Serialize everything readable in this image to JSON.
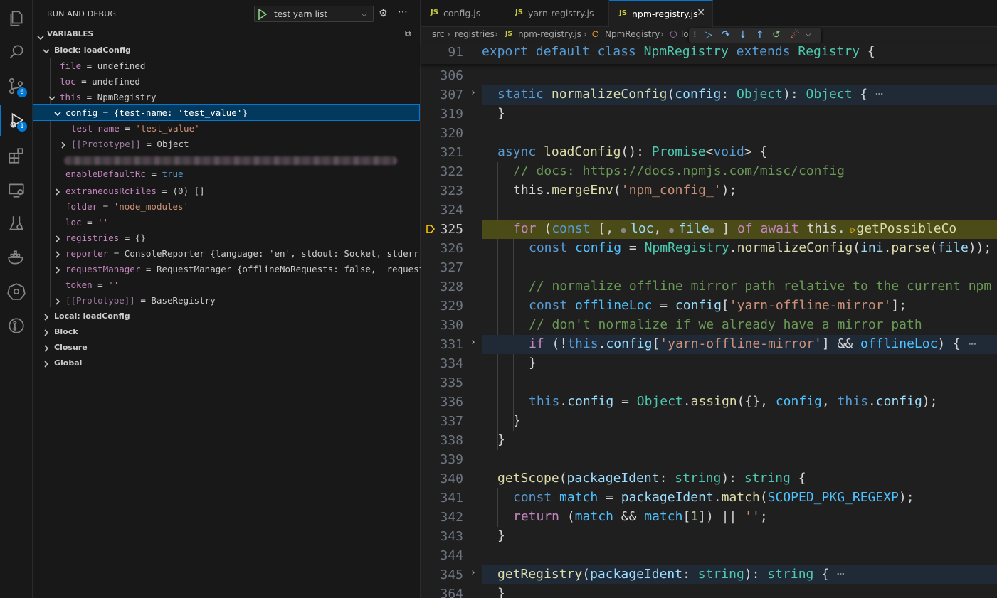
{
  "activity_bar": {
    "items": [
      {
        "name": "explorer",
        "icon": "files-icon"
      },
      {
        "name": "search",
        "icon": "search-icon"
      },
      {
        "name": "source-control",
        "icon": "source-control-icon",
        "badge": "6"
      },
      {
        "name": "run-and-debug",
        "icon": "debug-icon",
        "badge": "1",
        "active": true
      },
      {
        "name": "extensions",
        "icon": "extensions-icon"
      },
      {
        "name": "remote-explorer",
        "icon": "remote-explorer-icon"
      },
      {
        "name": "testing",
        "icon": "testing-icon"
      },
      {
        "name": "docker",
        "icon": "docker-icon"
      },
      {
        "name": "kubernetes",
        "icon": "kubernetes-icon"
      },
      {
        "name": "gitlens",
        "icon": "gitlens-icon"
      }
    ]
  },
  "sidebar": {
    "title": "RUN AND DEBUG",
    "launch_config": "test yarn list",
    "variables_title": "VARIABLES",
    "scopes": {
      "block_loadconfig": "Block: loadConfig",
      "local_loadconfig": "Local: loadConfig",
      "block": "Block",
      "closure": "Closure",
      "global": "Global"
    },
    "vars": {
      "file": {
        "name": "file",
        "value": "undefined"
      },
      "loc": {
        "name": "loc",
        "value": "undefined"
      },
      "this": {
        "name": "this",
        "value": "NpmRegistry"
      },
      "config": {
        "name": "config",
        "value": "{test-name: 'test_value'}"
      },
      "test_name": {
        "name": "test-name",
        "value": "'test_value'"
      },
      "proto1": {
        "name": "[[Prototype]]",
        "value": "Object"
      },
      "enable_default_rc": {
        "name": "enableDefaultRc",
        "value": "true"
      },
      "extraneous": {
        "name": "extraneousRcFiles",
        "value": "(0) []"
      },
      "folder": {
        "name": "folder",
        "value": "'node_modules'"
      },
      "loc2": {
        "name": "loc",
        "value": "''"
      },
      "registries": {
        "name": "registries",
        "value": "{}"
      },
      "reporter": {
        "name": "reporter",
        "value": "ConsoleReporter {language: 'en', stdout: Socket, stderr: …"
      },
      "request_manager": {
        "name": "requestManager",
        "value": "RequestManager {offlineNoRequests: false, _requestC…"
      },
      "token": {
        "name": "token",
        "value": "''"
      },
      "proto2": {
        "name": "[[Prototype]]",
        "value": "BaseRegistry"
      }
    }
  },
  "editor": {
    "tabs": [
      {
        "label": "config.js",
        "badge": "JS",
        "active": false
      },
      {
        "label": "yarn-registry.js",
        "badge": "JS",
        "active": false
      },
      {
        "label": "npm-registry.js",
        "badge": "JS",
        "active": true
      }
    ],
    "breadcrumbs": [
      "src",
      "registries",
      "npm-registry.js",
      "NpmRegistry",
      "lo"
    ],
    "sticky_line": {
      "num": "91",
      "text": "export default class NpmRegistry extends Registry {"
    },
    "current_line": "325",
    "lines": [
      {
        "num": "306"
      },
      {
        "num": "307"
      },
      {
        "num": "319"
      },
      {
        "num": "320"
      },
      {
        "num": "321"
      },
      {
        "num": "322"
      },
      {
        "num": "323"
      },
      {
        "num": "324"
      },
      {
        "num": "325"
      },
      {
        "num": "326"
      },
      {
        "num": "327"
      },
      {
        "num": "328"
      },
      {
        "num": "329"
      },
      {
        "num": "330"
      },
      {
        "num": "331"
      },
      {
        "num": "334"
      },
      {
        "num": "335"
      },
      {
        "num": "336"
      },
      {
        "num": "337"
      },
      {
        "num": "338"
      },
      {
        "num": "339"
      },
      {
        "num": "340"
      },
      {
        "num": "341"
      },
      {
        "num": "342"
      },
      {
        "num": "343"
      },
      {
        "num": "344"
      },
      {
        "num": "345"
      },
      {
        "num": "364"
      }
    ],
    "tokens": {
      "l307": [
        "static",
        "normalizeConfig",
        "(",
        "config",
        ": ",
        "Object",
        "): ",
        "Object",
        " {",
        "⋯"
      ],
      "l319": [
        "}"
      ],
      "l321": [
        "async",
        "loadConfig",
        "(): ",
        "Promise",
        "<",
        "void",
        "> {"
      ],
      "l322": [
        "// docs: ",
        "https://docs.npmjs.com/misc/config"
      ],
      "l323": [
        "this",
        ".",
        "mergeEnv",
        "(",
        "'npm_config_'",
        ");"
      ],
      "l325": [
        "for",
        " (",
        "const",
        " [, ",
        "loc",
        ", ",
        "file",
        " ] ",
        "of",
        " ",
        "await",
        " ",
        "this",
        ".",
        "getPossibleCo"
      ],
      "l326": [
        "const",
        " ",
        "config",
        " = ",
        "NpmRegistry",
        ".",
        "normalizeConfig",
        "(",
        "ini",
        ".",
        "parse",
        "(",
        "file",
        "));"
      ],
      "l328": [
        "// normalize offline mirror path relative to the current npm"
      ],
      "l329": [
        "const",
        " ",
        "offlineLoc",
        " = ",
        "config",
        "[",
        "'yarn-offline-mirror'",
        "];"
      ],
      "l330": [
        "// don't normalize if we already have a mirror path"
      ],
      "l331": [
        "if",
        " (!",
        "this",
        ".",
        "config",
        "[",
        "'yarn-offline-mirror'",
        "] && ",
        "offlineLoc",
        ") {",
        "⋯"
      ],
      "l334": [
        "}"
      ],
      "l336": [
        "this",
        ".",
        "config",
        " = ",
        "Object",
        ".",
        "assign",
        "({}, ",
        "config",
        ", ",
        "this",
        ".",
        "config",
        ");"
      ],
      "l337": [
        "}"
      ],
      "l338": [
        "}"
      ],
      "l340": [
        "getScope",
        "(",
        "packageIdent",
        ": ",
        "string",
        "): ",
        "string",
        " {"
      ],
      "l341": [
        "const",
        " ",
        "match",
        " = ",
        "packageIdent",
        ".",
        "match",
        "(",
        "SCOPED_PKG_REGEXP",
        ");"
      ],
      "l342": [
        "return",
        " (",
        "match",
        " && ",
        "match",
        "[",
        "1",
        "]) || ",
        "''",
        ";"
      ],
      "l343": [
        "}"
      ],
      "l345": [
        "getRegistry",
        "(",
        "packageIdent",
        ": ",
        "string",
        "): ",
        "string",
        " {",
        "⋯"
      ],
      "l364": [
        "}"
      ],
      "sticky": [
        "export",
        " ",
        "default",
        " ",
        "class",
        " ",
        "NpmRegistry",
        " ",
        "extends",
        " ",
        "Registry",
        " {"
      ]
    }
  }
}
